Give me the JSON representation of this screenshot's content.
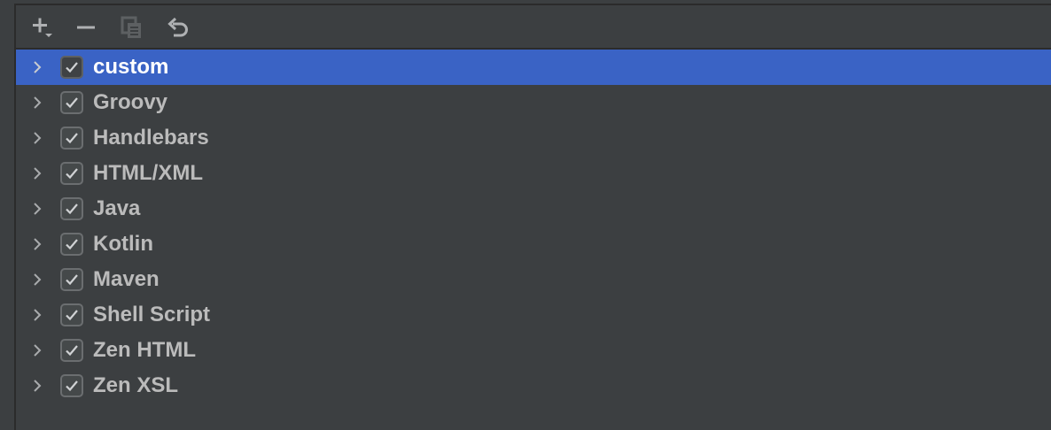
{
  "toolbar": {
    "buttons": [
      {
        "name": "add-icon",
        "tooltip": ""
      },
      {
        "name": "remove-icon",
        "tooltip": ""
      },
      {
        "name": "copy-icon",
        "tooltip": ""
      },
      {
        "name": "undo-icon",
        "tooltip": ""
      }
    ]
  },
  "colors": {
    "background": "#3c3f41",
    "selection": "#3a63c5",
    "text": "#bbbbbb",
    "selected_text": "#ffffff"
  },
  "tree": {
    "items": [
      {
        "label": "custom",
        "checked": true,
        "selected": true
      },
      {
        "label": "Groovy",
        "checked": true,
        "selected": false
      },
      {
        "label": "Handlebars",
        "checked": true,
        "selected": false
      },
      {
        "label": "HTML/XML",
        "checked": true,
        "selected": false
      },
      {
        "label": "Java",
        "checked": true,
        "selected": false
      },
      {
        "label": "Kotlin",
        "checked": true,
        "selected": false
      },
      {
        "label": "Maven",
        "checked": true,
        "selected": false
      },
      {
        "label": "Shell Script",
        "checked": true,
        "selected": false
      },
      {
        "label": "Zen HTML",
        "checked": true,
        "selected": false
      },
      {
        "label": "Zen XSL",
        "checked": true,
        "selected": false
      }
    ]
  }
}
